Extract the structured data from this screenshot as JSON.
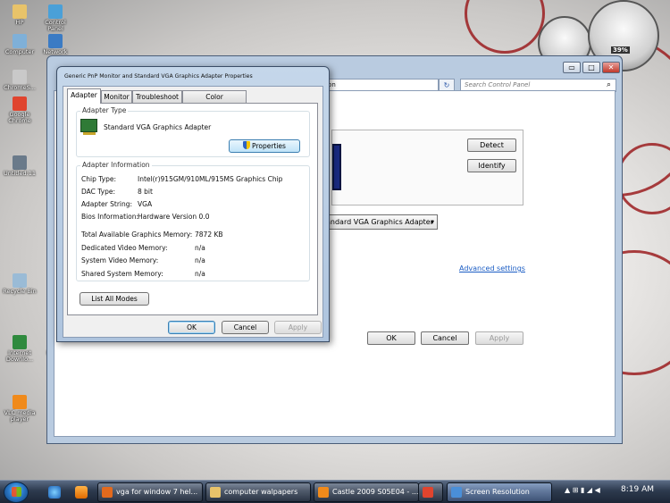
{
  "desktop_icons": [
    {
      "name": "hp-icon",
      "label": "HP",
      "color": "#e8c36a"
    },
    {
      "name": "control-panel-icon",
      "label": "Control Panel",
      "color": "#4aa0d8"
    },
    {
      "name": "computer-icon",
      "label": "Computer",
      "color": "#7fb0d8"
    },
    {
      "name": "network-icon",
      "label": "Network",
      "color": "#3b7bc4"
    },
    {
      "name": "chrome-icon",
      "label": "ChromeS...",
      "color": "#c9c9c9"
    },
    {
      "name": "google-chrome-icon",
      "label": "Google Chrome",
      "color": "#e0442e"
    },
    {
      "name": "untitled-icon",
      "label": "Untitled.11",
      "color": "#6a7a8a"
    },
    {
      "name": "recycle-bin-icon",
      "label": "Recycle Bin",
      "color": "#9abbd6"
    },
    {
      "name": "ie-icon",
      "label": "Internet Downlo...",
      "color": "#2f8a3e"
    },
    {
      "name": "mozilla-icon",
      "label": "Mo Fir",
      "color": "#d96b1d"
    },
    {
      "name": "vlc-icon",
      "label": "VLC media player",
      "color": "#f08a1b"
    }
  ],
  "gadget": {
    "cpu_percent": "39%"
  },
  "bg_window": {
    "address": "ution",
    "search_placeholder": "Search Control Panel",
    "detect_label": "Detect",
    "identify_label": "Identify",
    "display_select": "andard VGA Graphics Adapter",
    "advanced_settings": "Advanced settings",
    "ok_label": "OK",
    "cancel_label": "Cancel",
    "apply_label": "Apply",
    "min_glyph": "▭",
    "max_glyph": "□",
    "close_glyph": "✕"
  },
  "dialog": {
    "title": "Generic PnP Monitor and Standard VGA Graphics Adapter Properties",
    "tabs": [
      "Adapter",
      "Monitor",
      "Troubleshoot",
      "Color Management"
    ],
    "adapter_type_label": "Adapter Type",
    "adapter_name": "Standard VGA Graphics Adapter",
    "properties_label": "Properties",
    "adapter_info_label": "Adapter Information",
    "info_rows": [
      {
        "label": "Chip Type:",
        "value": "Intel(r)915GM/910ML/915MS Graphics Chip"
      },
      {
        "label": "DAC Type:",
        "value": "8 bit"
      },
      {
        "label": "Adapter String:",
        "value": "VGA"
      },
      {
        "label": "Bios Information:",
        "value": "Hardware Version 0.0"
      }
    ],
    "memory_rows": [
      {
        "label": "Total Available Graphics Memory:",
        "value": "7872 KB"
      },
      {
        "label": "Dedicated Video Memory:",
        "value": "n/a"
      },
      {
        "label": "System Video Memory:",
        "value": "n/a"
      },
      {
        "label": "Shared System Memory:",
        "value": "n/a"
      }
    ],
    "list_all_modes_label": "List All Modes",
    "ok_label": "OK",
    "cancel_label": "Cancel",
    "apply_label": "Apply"
  },
  "taskbar": {
    "buttons": [
      {
        "name": "taskbar-firefox",
        "label": "vga for window 7 hel...",
        "color": "#e36a1d",
        "active": false
      },
      {
        "name": "taskbar-folder",
        "label": "computer walpapers",
        "color": "#e8c36a",
        "active": false
      },
      {
        "name": "taskbar-vlc",
        "label": "Castle 2009 S05E04 - ...",
        "color": "#f08a1b",
        "active": false
      },
      {
        "name": "taskbar-chrome",
        "label": "",
        "color": "#e0442e",
        "active": false
      },
      {
        "name": "taskbar-screen-resolution",
        "label": "Screen Resolution",
        "color": "#4a8fd8",
        "active": true
      }
    ],
    "tray_glyphs": "▲ ⊞ ▮ ◢ ◀",
    "clock": "8:19 AM"
  },
  "colors": {
    "accent_red": "#9b1d20",
    "link": "#1a5cc4"
  }
}
